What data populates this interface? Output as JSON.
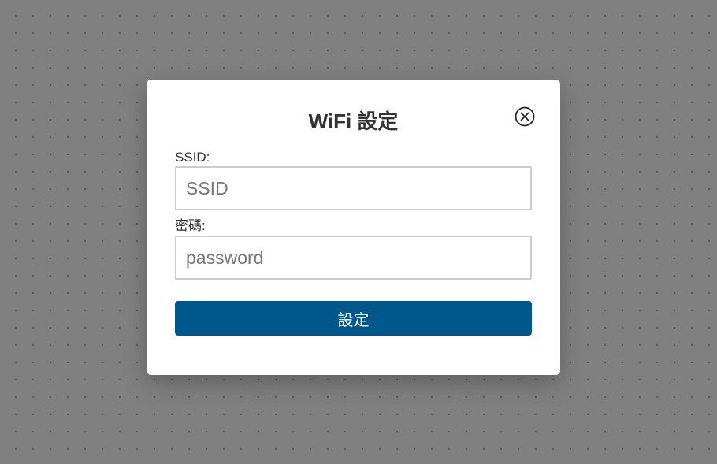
{
  "dialog": {
    "title": "WiFi 設定",
    "close_icon": "circle-close-icon"
  },
  "form": {
    "ssid": {
      "label": "SSID:",
      "placeholder": "SSID",
      "value": ""
    },
    "password": {
      "label": "密碼:",
      "placeholder": "password",
      "value": ""
    },
    "submit_label": "設定"
  },
  "colors": {
    "backdrop": "#808080",
    "dialog_background": "#ffffff",
    "primary_button": "#00578c",
    "input_border": "#cccccc",
    "text": "#333333"
  }
}
